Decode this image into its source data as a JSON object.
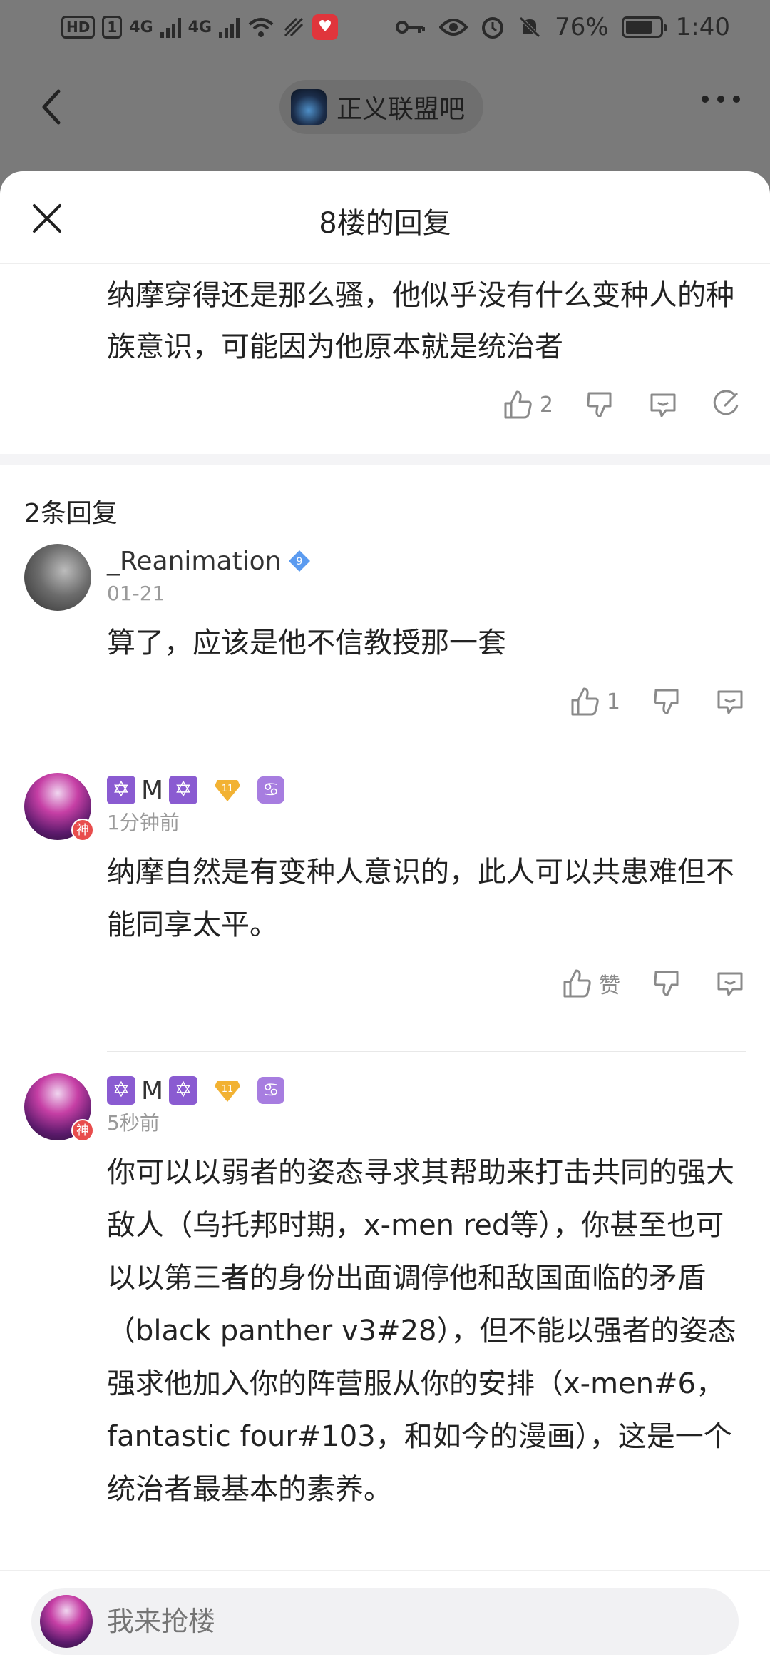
{
  "status_bar": {
    "hd": "HD",
    "sim": "1",
    "net1": "4G",
    "net2": "4G",
    "battery": "76%",
    "time": "1:40"
  },
  "nav": {
    "forum_name": "正义联盟吧"
  },
  "sheet": {
    "title": "8楼的回复",
    "main_text": "纳摩穿得还是那么骚，他似乎没有什么变种人的种族意识，可能因为他原本就是统治者",
    "main_like_count": "2",
    "reply_count_label": "2条回复"
  },
  "replies": [
    {
      "user": "_Reanimation",
      "verified_level": "9",
      "time": "01-21",
      "text": "算了，应该是他不信教授那一套",
      "like": "1"
    },
    {
      "user_mid": "M",
      "level": "11",
      "zodiac": "♋",
      "god_badge": "神",
      "time": "1分钟前",
      "text": "纳摩自然是有变种人意识的，此人可以共患难但不能同享太平。",
      "like": "赞"
    },
    {
      "user_mid": "M",
      "level": "11",
      "zodiac": "♋",
      "god_badge": "神",
      "time": "5秒前",
      "text": "你可以以弱者的姿态寻求其帮助来打击共同的强大敌人（乌托邦时期，x-men red等），你甚至也可以以第三者的身份出面调停他和敌国面临的矛盾（black panther v3#28），但不能以强者的姿态强求他加入你的阵营服从你的安排（x-men#6，fantastic four#103，和如今的漫画），这是一个统治者最基本的素养。"
    }
  ],
  "input": {
    "placeholder": "我来抢楼"
  },
  "icons": {
    "star": "✡",
    "back": "chevron-left-icon",
    "close": "close-icon",
    "more": "more-icon",
    "like": "thumbs-up-icon",
    "dislike": "thumbs-down-icon",
    "comment": "comment-icon",
    "edit": "edit-icon"
  },
  "colors": {
    "badge_purple": "#8a5bd1",
    "level_gold": "#f2b233",
    "verified_blue": "#5b9bf0"
  }
}
